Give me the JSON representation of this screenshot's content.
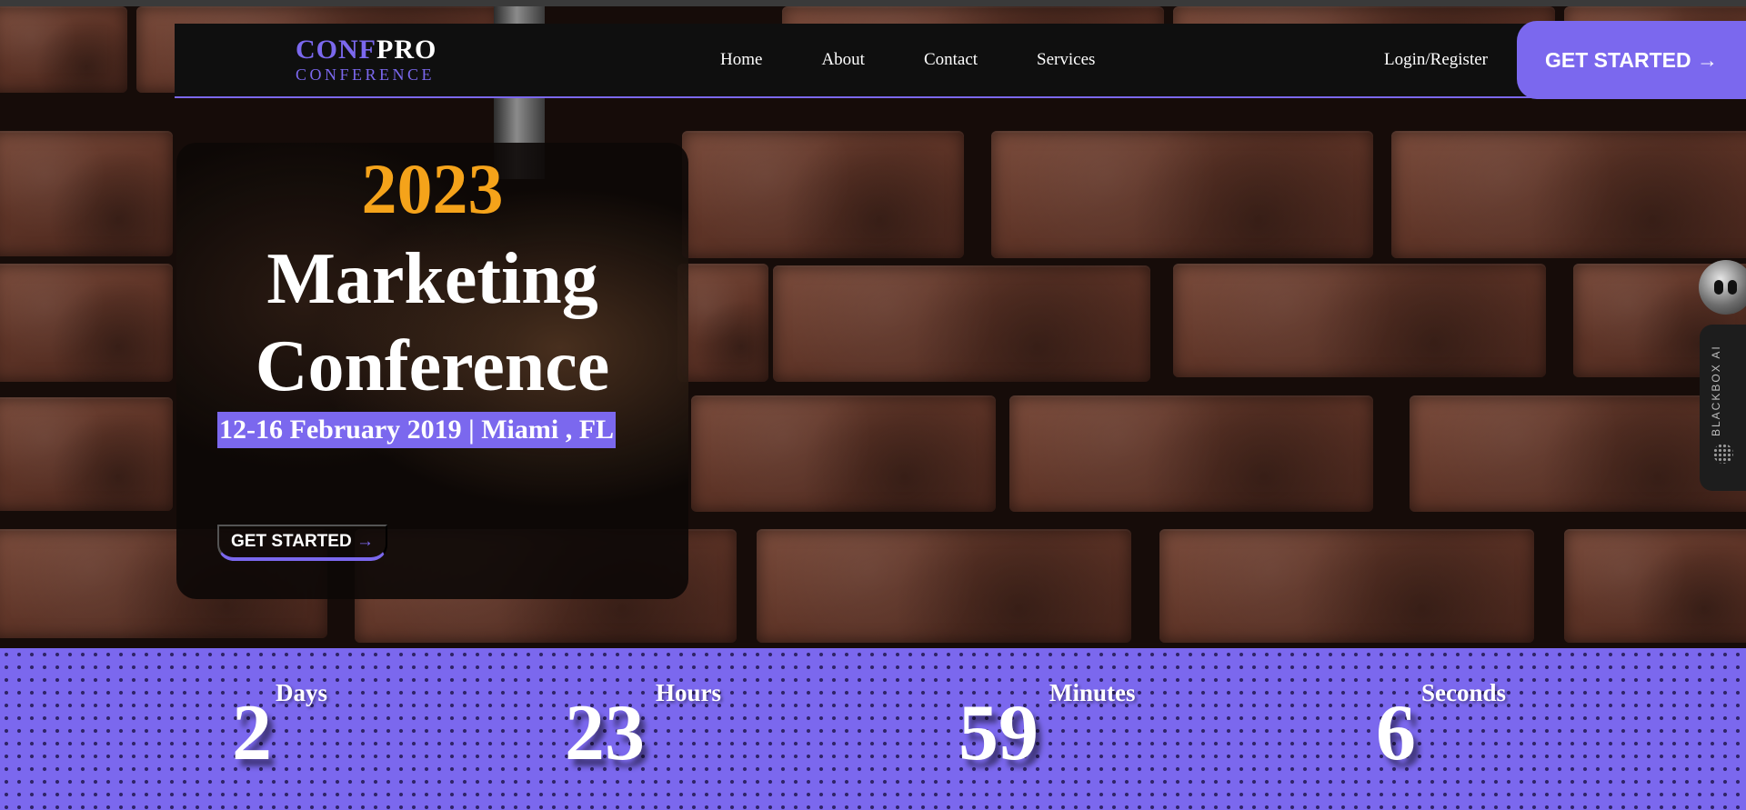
{
  "nav": {
    "logo_part1": "CONF",
    "logo_part2": "PRO",
    "logo_sub": "CONFERENCE",
    "links": [
      "Home",
      "About",
      "Contact",
      "Services"
    ],
    "login": "Login/Register",
    "cta": "GET STARTED →"
  },
  "hero": {
    "year": "2023",
    "title_line1": "Marketing",
    "title_line2": "Conference",
    "dateline": "12-16 February 2019 | Miami , FL",
    "cta_label": "GET STARTED",
    "cta_arrow": "→"
  },
  "countdown": [
    {
      "value": "2",
      "unit": "Days"
    },
    {
      "value": "23",
      "unit": "Hours"
    },
    {
      "value": "59",
      "unit": "Minutes"
    },
    {
      "value": "6",
      "unit": "Seconds"
    }
  ],
  "widget": {
    "label": "BLACKBOX AI"
  },
  "colors": {
    "accent": "#7b68ee",
    "year": "#f5a31a",
    "nav_bg": "#0f0f0f"
  },
  "icons": [
    "arrow-right-icon",
    "blackbox-bot-icon",
    "blackbox-dots-icon"
  ]
}
